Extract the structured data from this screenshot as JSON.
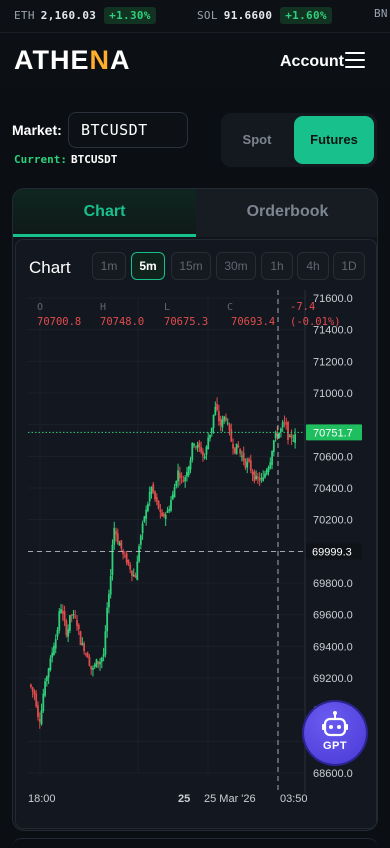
{
  "ticker": [
    {
      "symbol": "ETH",
      "price": "2,160.03",
      "change": "+1.30%"
    },
    {
      "symbol": "SOL",
      "price": "91.6600",
      "change": "+1.60%"
    },
    {
      "symbol": "BN",
      "price": "",
      "change": ""
    }
  ],
  "header": {
    "logo_pre": "ATHE",
    "logo_acc": "N",
    "logo_post": "A",
    "account_label": "Account",
    "menu_icon": "hamburger-menu-icon"
  },
  "market": {
    "label": "Market:",
    "value": "BTCUSDT",
    "current_label": "Current:",
    "current_value": "BTCUSDT",
    "mode_options": [
      "Spot",
      "Futures"
    ],
    "selected_mode": "Futures"
  },
  "tabs": {
    "chart": "Chart",
    "orderbook": "Orderbook",
    "selected": "Chart"
  },
  "chart": {
    "title": "Chart",
    "timeframes": [
      "1m",
      "5m",
      "15m",
      "30m",
      "1h",
      "4h",
      "1D"
    ],
    "selected_timeframe": "5m"
  },
  "colors": {
    "accent": "#18c08b",
    "up": "#2fd07a",
    "down": "#e04c4c",
    "logo_accent": "#ffad2a",
    "gpt": "#5a4ae6"
  },
  "chart_data": {
    "type": "candlestick",
    "ohlc_header": {
      "labels": [
        "O",
        "H",
        "L",
        "C"
      ],
      "values": [
        "70700.8",
        "70748.0",
        "70675.3",
        "70693.4"
      ],
      "change": "-7.4",
      "change_pct": "(-0.01%)"
    },
    "y_ticks": [
      "71600.0",
      "71400.0",
      "71200.0",
      "71000.0",
      "70800.0",
      "70600.0",
      "70400.0",
      "70200.0",
      "70000.0",
      "69800.0",
      "69600.0",
      "69400.0",
      "69200.0",
      "69000.0",
      "68800.0",
      "68600.0"
    ],
    "ylim": [
      68600,
      71600
    ],
    "x_labels": [
      "18:00",
      "25",
      "25 Mar '26",
      "03:50"
    ],
    "last_price": "70751.7",
    "last_price_value": 70751.7,
    "crosshair_price": "69999.3",
    "crosshair_price_value": 69999.3,
    "closes": [
      69100,
      68950,
      69150,
      69300,
      69450,
      69650,
      69500,
      69600,
      69550,
      69400,
      69350,
      69250,
      69300,
      69350,
      69700,
      70150,
      70050,
      69950,
      69900,
      69850,
      70100,
      70250,
      70400,
      70300,
      70200,
      70250,
      70350,
      70500,
      70450,
      70550,
      70700,
      70650,
      70600,
      70750,
      70900,
      70800,
      70850,
      70700,
      70650,
      70600,
      70550,
      70500,
      70450,
      70450,
      70550,
      70700,
      70750,
      70800,
      70700,
      70720
    ]
  },
  "gpt": {
    "label": "GPT",
    "icon": "robot-icon"
  }
}
